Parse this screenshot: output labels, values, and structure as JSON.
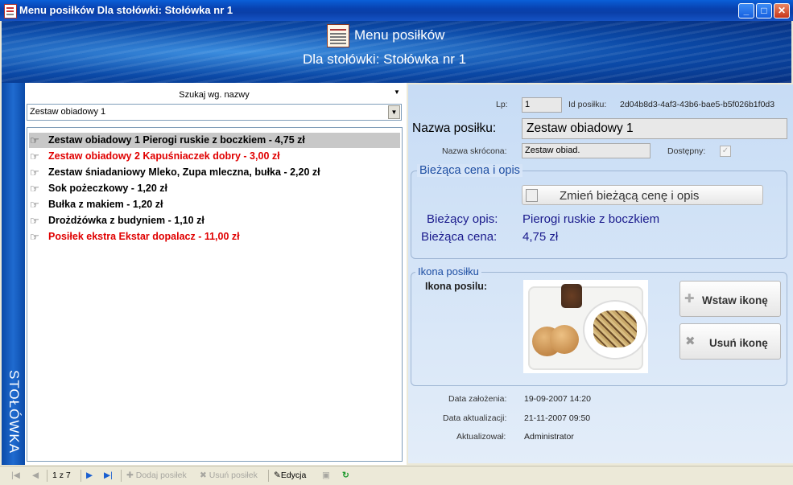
{
  "window": {
    "title": "Menu posiłków  Dla stołówki: Stołówka nr 1",
    "minimize": "_",
    "maximize": "□",
    "close": "✕"
  },
  "banner": {
    "title": "Menu posiłków",
    "subtitle": "Dla stołówki: Stołówka nr 1",
    "icon": "menu-card-icon"
  },
  "sidebar_label": "STOŁÓWKA",
  "search": {
    "mode_label": "Szukaj wg. nazwy",
    "value": "Zestaw obiadowy 1"
  },
  "meals": [
    {
      "label": "Zestaw obiadowy 1 Pierogi ruskie z boczkiem - 4,75 zł",
      "selected": true,
      "color": "#000000"
    },
    {
      "label": "Zestaw obiadowy  2 Kapuśniaczek dobry - 3,00 zł",
      "selected": false,
      "color": "#e00000"
    },
    {
      "label": "Zestaw śniadaniowy Mleko, Zupa mleczna, bułka - 2,20 zł",
      "selected": false,
      "color": "#000000"
    },
    {
      "label": "Sok pożeczkowy - 1,20 zł",
      "selected": false,
      "color": "#000000"
    },
    {
      "label": "Bułka z makiem - 1,20 zł",
      "selected": false,
      "color": "#000000"
    },
    {
      "label": "Drożdżówka z budyniem - 1,10 zł",
      "selected": false,
      "color": "#000000"
    },
    {
      "label": "Posiłek ekstra Ekstar dopalacz - 11,00 zł",
      "selected": false,
      "color": "#e00000"
    }
  ],
  "list_item_icon": "pointing-hand-icon",
  "details": {
    "lp_label": "Lp:",
    "lp_value": "1",
    "id_label": "Id posiłku:",
    "id_value": "2d04b8d3-4af3-43b6-bae5-b5f026b1f0d3",
    "name_label": "Nazwa posiłku:",
    "name_value": "Zestaw obiadowy 1",
    "short_label": "Nazwa skrócona:",
    "short_value": "Zestaw obiad.",
    "available_label": "Dostępny:",
    "available_checked": true
  },
  "price_group": {
    "title": "Bieżąca cena i opis",
    "change_button": "Zmień bieżącą cenę i opis",
    "desc_label": "Bieżący opis:",
    "desc_value": "Pierogi ruskie z boczkiem",
    "price_label": "Bieżąca cena:",
    "price_value": "4,75 zł"
  },
  "icon_group": {
    "title": "Ikona posiłku",
    "icon_label": "Ikona posilu:",
    "insert_button": "Wstaw ikonę",
    "remove_button": "Usuń ikonę"
  },
  "audit": {
    "created_label": "Data założenia:",
    "created_value": "19-09-2007 14:20",
    "updated_label": "Data aktualizacji:",
    "updated_value": "21-11-2007 09:50",
    "updated_by_label": "Aktualizował:",
    "updated_by_value": "Administrator"
  },
  "toolbar": {
    "record_position": "1  z 7",
    "add_label": "Dodaj posiłek",
    "delete_label": "Usuń posiłek",
    "edit_label": "Edycja"
  }
}
